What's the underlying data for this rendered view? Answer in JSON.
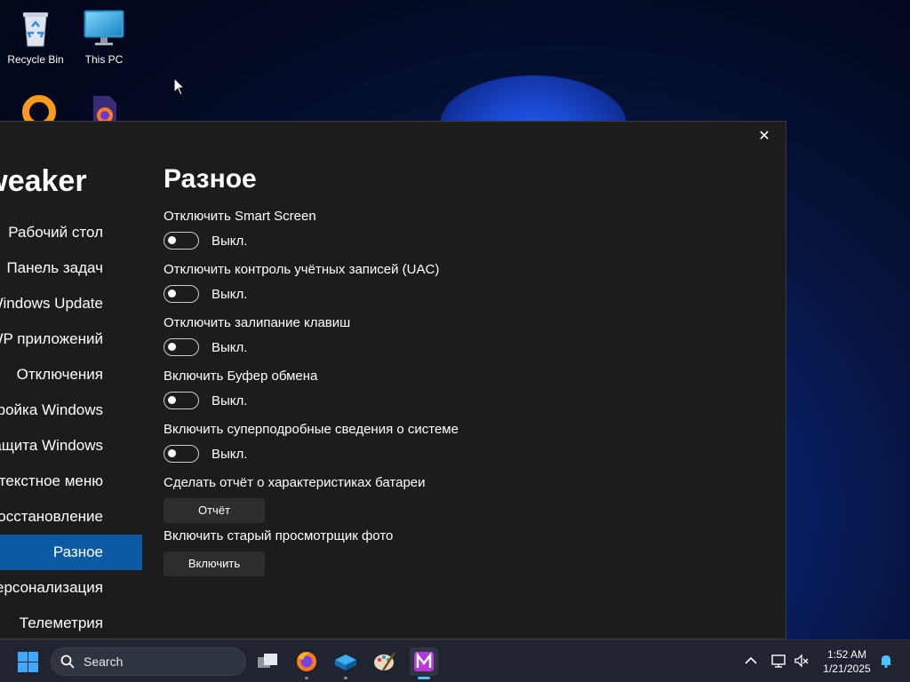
{
  "desktop": {
    "icons": [
      {
        "label": "Recycle Bin",
        "icon": "recycle-bin-icon"
      },
      {
        "label": "This PC",
        "icon": "monitor-icon"
      },
      {
        "label": "",
        "icon": "circular-app-icon"
      },
      {
        "label": "",
        "icon": "firefox-file-icon"
      }
    ]
  },
  "window": {
    "app_title": "Tweaker",
    "close_label": "✕",
    "nav": [
      "Рабочий стол",
      "Панель задач",
      "Windows Update",
      "UWP приложений",
      "Отключения",
      "Настройка Windows",
      "Защита Windows",
      "Контекстное меню",
      "Восстановление",
      "Разное",
      "Персонализация",
      "Телеметрия"
    ],
    "active_nav_index": 9,
    "page_title": "Разное",
    "toggles": [
      {
        "label": "Отключить Smart Screen",
        "state": "Выкл.",
        "on": false
      },
      {
        "label": "Отключить контроль учётных записей (UAC)",
        "state": "Выкл.",
        "on": false
      },
      {
        "label": "Отключить залипание клавиш",
        "state": "Выкл.",
        "on": false
      },
      {
        "label": "Включить Буфер обмена",
        "state": "Выкл.",
        "on": false
      },
      {
        "label": "Включить суперподробные сведения о системе",
        "state": "Выкл.",
        "on": false
      }
    ],
    "actions": [
      {
        "label": "Сделать отчёт о характеристиках батареи",
        "button": "Отчёт"
      },
      {
        "label": "Включить старый просмотрщик фото",
        "button": "Включить"
      }
    ]
  },
  "taskbar": {
    "search_placeholder": "Search",
    "apps": [
      "task-view-icon",
      "firefox-icon",
      "box-app-icon",
      "paint-icon",
      "tweaker-app-icon"
    ],
    "clock": {
      "time": "1:52 AM",
      "date": "1/21/2025"
    }
  },
  "colors": {
    "accent": "#0b5aa3",
    "window_bg": "#1c1c1c",
    "taskbar_bg": "#1f2430",
    "active_indicator": "#4cc2ff"
  }
}
